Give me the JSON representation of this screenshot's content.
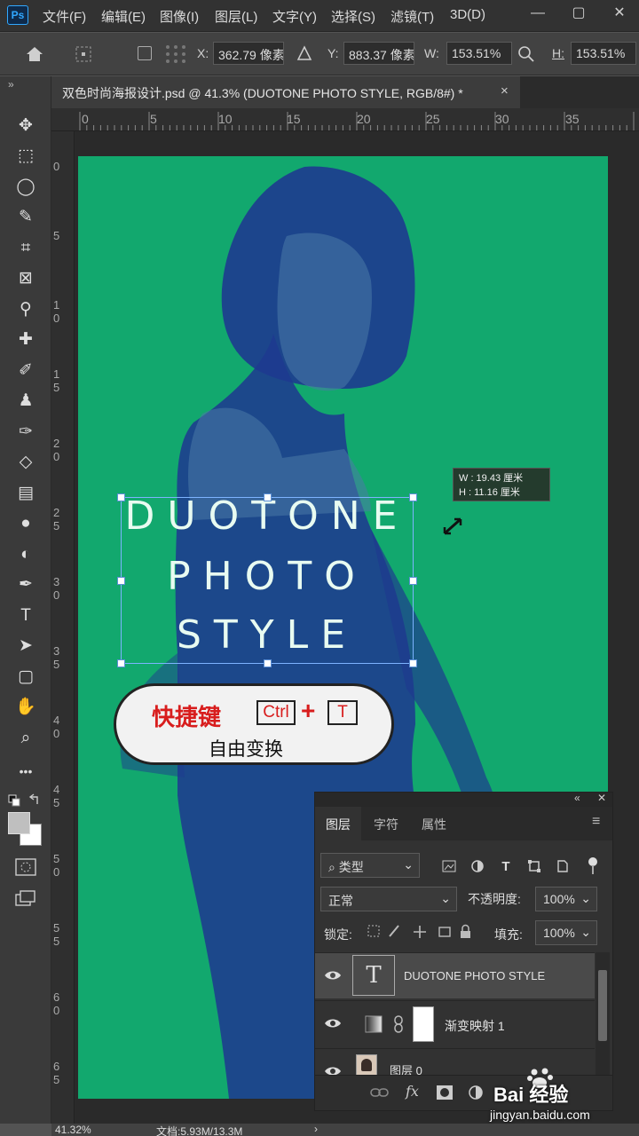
{
  "app": {
    "logo": "Ps"
  },
  "menu": [
    "文件(F)",
    "编辑(E)",
    "图像(I)",
    "图层(L)",
    "文字(Y)",
    "选择(S)",
    "滤镜(T)",
    "3D(D)"
  ],
  "window_controls": {
    "minimize": "—",
    "restore": "▢",
    "close": "✕"
  },
  "options": {
    "x_label": "X:",
    "x_value": "362.79 像素",
    "y_label": "Y:",
    "y_value": "883.37 像素",
    "w_label": "W:",
    "w_value": "153.51%",
    "h_label": "H:",
    "h_value": "153.51%"
  },
  "document_tab": {
    "title": "双色时尚海报设计.psd @ 41.3% (DUOTONE PHOTO STYLE, RGB/8#) *",
    "close": "×"
  },
  "toolbar": {
    "collapse": "»",
    "more": "•••"
  },
  "tools": [
    {
      "name": "move-icon",
      "glyph": "✥"
    },
    {
      "name": "marquee-icon",
      "glyph": "⬚"
    },
    {
      "name": "lasso-icon",
      "glyph": "◯"
    },
    {
      "name": "quick-select-icon",
      "glyph": "✎"
    },
    {
      "name": "crop-icon",
      "glyph": "⌗"
    },
    {
      "name": "frame-icon",
      "glyph": "⊠"
    },
    {
      "name": "eyedropper-icon",
      "glyph": "⚲"
    },
    {
      "name": "healing-icon",
      "glyph": "✚"
    },
    {
      "name": "brush-icon",
      "glyph": "✐"
    },
    {
      "name": "stamp-icon",
      "glyph": "♟"
    },
    {
      "name": "history-brush-icon",
      "glyph": "✑"
    },
    {
      "name": "eraser-icon",
      "glyph": "◇"
    },
    {
      "name": "gradient-icon",
      "glyph": "▤"
    },
    {
      "name": "blur-icon",
      "glyph": "●"
    },
    {
      "name": "dodge-icon",
      "glyph": "◐"
    },
    {
      "name": "pen-icon",
      "glyph": "✒"
    },
    {
      "name": "type-icon",
      "glyph": "T"
    },
    {
      "name": "path-select-icon",
      "glyph": "➤"
    },
    {
      "name": "rectangle-icon",
      "glyph": "▢"
    },
    {
      "name": "hand-icon",
      "glyph": "✋"
    },
    {
      "name": "zoom-icon",
      "glyph": "⌕"
    }
  ],
  "ruler": {
    "top": [
      "0",
      "5",
      "10",
      "15",
      "20",
      "25",
      "30",
      "35"
    ],
    "left": [
      "0",
      "5",
      "1 0",
      "1 5",
      "2 0",
      "2 5",
      "3 0",
      "3 5",
      "4 0",
      "4 5",
      "5 0",
      "5 5",
      "6 0",
      "6 5"
    ]
  },
  "canvas_text": {
    "line1": "DUOTONE",
    "line2": "PHOTO",
    "line3": "STYLE"
  },
  "transform_tooltip": {
    "w": "W :   19.43 厘米",
    "h": "H :   11.16 厘米"
  },
  "callout": {
    "title": "快捷键",
    "key1": "Ctrl",
    "plus": "+",
    "key2": "T",
    "subtitle": "自由变换"
  },
  "layers_panel": {
    "tabs": [
      "图层",
      "字符",
      "属性"
    ],
    "filter_label": "类型",
    "blend_mode": "正常",
    "opacity_label": "不透明度:",
    "opacity_value": "100%",
    "lock_label": "锁定:",
    "fill_label": "填充:",
    "fill_value": "100%",
    "layers": [
      {
        "name": "DUOTONE PHOTO STYLE",
        "type": "text"
      },
      {
        "name": "渐变映射 1",
        "type": "adjustment"
      },
      {
        "name": "图层 0",
        "type": "image"
      }
    ],
    "bottom_fx": "fx"
  },
  "status": {
    "zoom": "41.32%",
    "doc": "文档:5.93M/13.3M",
    "arrow": "›"
  },
  "watermark": {
    "brand": "Bai 经验",
    "url": "jingyan.baidu.com"
  },
  "colors": {
    "canvas": "#12a86e",
    "duotone_dark": "#1e3a8f",
    "accent_red": "#d81d1d",
    "selection": "#7db3ff"
  }
}
